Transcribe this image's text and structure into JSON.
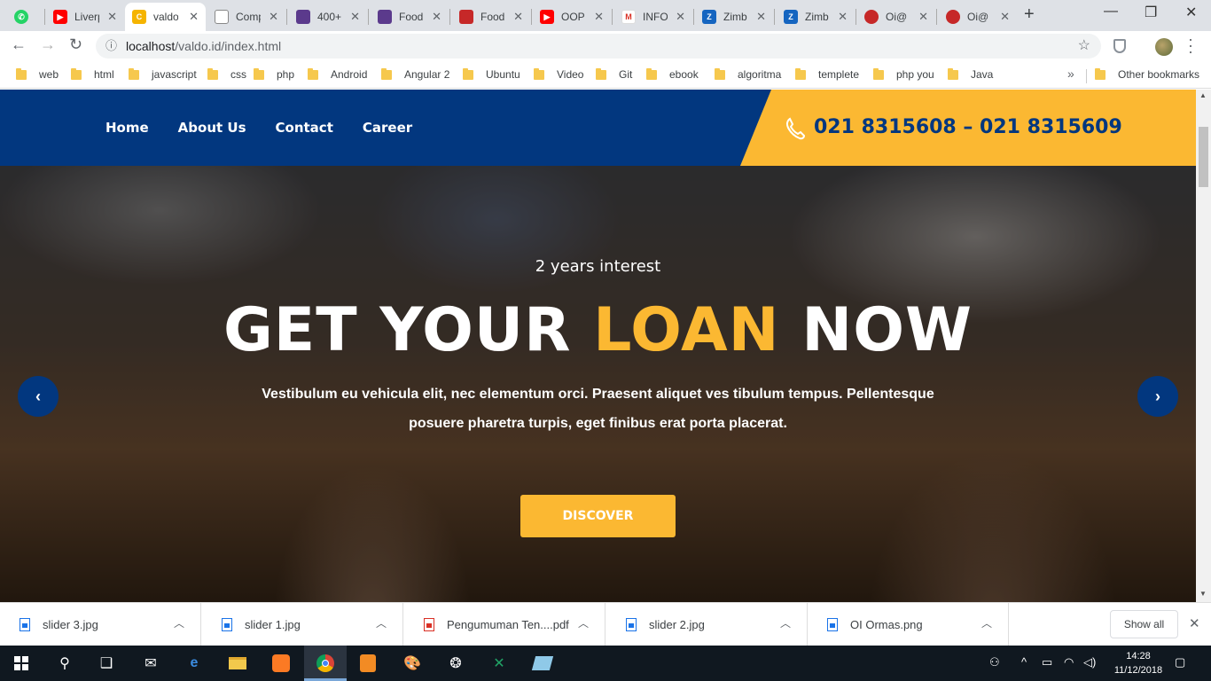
{
  "browser": {
    "tabs": [
      {
        "label": "",
        "icon": "whatsapp-icon",
        "color": "#25d366"
      },
      {
        "label": "Liverp",
        "icon": "youtube-icon",
        "color": "#ff0000"
      },
      {
        "label": "valdo",
        "icon": "c-logo-icon",
        "color": "#f5b400",
        "active": true
      },
      {
        "label": "Comp",
        "icon": "document-icon",
        "color": "#888888"
      },
      {
        "label": "400+",
        "icon": "colorlib-icon",
        "color": "#5b3a8c"
      },
      {
        "label": "Food",
        "icon": "colorlib-icon",
        "color": "#5b3a8c"
      },
      {
        "label": "Food",
        "icon": "flag-icon",
        "color": "#c62828"
      },
      {
        "label": "OOP",
        "icon": "youtube-icon",
        "color": "#ff0000"
      },
      {
        "label": "INFO",
        "icon": "gmail-icon",
        "color": "#d93025"
      },
      {
        "label": "Zimb",
        "icon": "zimbra-icon",
        "color": "#1565c0"
      },
      {
        "label": "Zimb",
        "icon": "zimbra-icon",
        "color": "#1565c0"
      },
      {
        "label": "Oi@",
        "icon": "oi-icon",
        "color": "#c62828"
      },
      {
        "label": "Oi@",
        "icon": "oi-icon",
        "color": "#c62828"
      }
    ],
    "url_host": "localhost",
    "url_path": "/valdo.id/index.html",
    "bookmarks": [
      "web",
      "html",
      "javascript",
      "css",
      "php",
      "Android",
      "Angular 2",
      "Ubuntu",
      "Video",
      "Git",
      "ebook",
      "algoritma",
      "templete",
      "php you",
      "Java"
    ],
    "other_bookmarks": "Other bookmarks",
    "overflow": "»"
  },
  "site": {
    "nav": [
      "Home",
      "About Us",
      "Contact",
      "Career"
    ],
    "phone": "021 8315608 – 021 8315609",
    "hero": {
      "subtitle": "2 years interest",
      "title_part1": "GET YOUR ",
      "title_accent": "LOAN",
      "title_part2": " NOW",
      "description": "Vestibulum eu vehicula elit, nec elementum orci. Praesent aliquet ves tibulum tempus. Pellentesque posuere pharetra turpis, eget finibus erat porta placerat.",
      "cta": "DISCOVER",
      "prev": "‹",
      "next": "›"
    },
    "colors": {
      "primary": "#02377f",
      "accent": "#fbb832"
    }
  },
  "downloads": {
    "items": [
      {
        "name": "slider 3.jpg",
        "type": "image"
      },
      {
        "name": "slider 1.jpg",
        "type": "image"
      },
      {
        "name": "Pengumuman Ten....pdf",
        "type": "pdf"
      },
      {
        "name": "slider 2.jpg",
        "type": "image"
      },
      {
        "name": "OI Ormas.png",
        "type": "image"
      }
    ],
    "show_all": "Show all"
  },
  "taskbar": {
    "time": "14:28",
    "date": "11/12/2018"
  }
}
